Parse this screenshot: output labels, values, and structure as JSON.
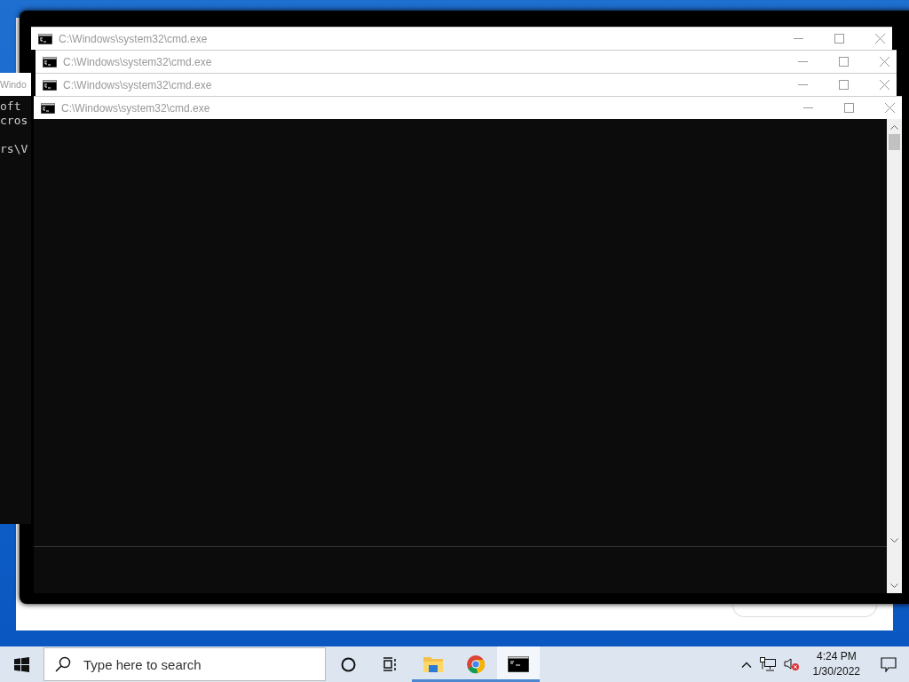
{
  "console_window": {
    "title": "Windo",
    "lines": [
      "oft",
      "cros",
      "rs\\V"
    ]
  },
  "cmd_windows": [
    {
      "title": "C:\\Windows\\system32\\cmd.exe"
    },
    {
      "title": "C:\\Windows\\system32\\cmd.exe"
    },
    {
      "title": "C:\\Windows\\system32\\cmd.exe"
    },
    {
      "title": "C:\\Windows\\system32\\cmd.exe"
    }
  ],
  "taskbar": {
    "search": {
      "placeholder": "Type here to search"
    },
    "apps": [
      {
        "kind": "folder",
        "running": true,
        "selected": false
      },
      {
        "kind": "chrome",
        "running": true,
        "selected": false
      },
      {
        "kind": "console",
        "running": true,
        "selected": true
      }
    ],
    "clock": {
      "time": "4:24 PM",
      "date": "1/30/2022"
    }
  }
}
